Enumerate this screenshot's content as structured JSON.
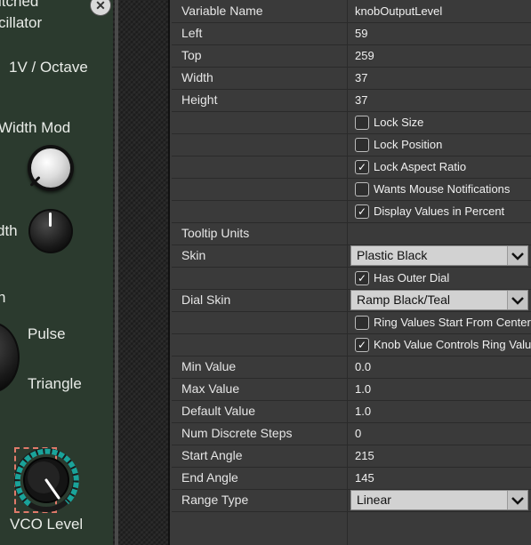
{
  "module": {
    "title_partial": "itched",
    "subtitle_partial": "cillator",
    "labels": {
      "one_v_octave": "1V / Octave",
      "width_mod": "Width Mod",
      "dth": "dth",
      "h": "h",
      "pulse": "Pulse",
      "triangle": "Triangle",
      "vco_level": "VCO Level"
    },
    "accent_color": "#1aa39a",
    "selection_color": "#e07a6a"
  },
  "properties": {
    "rows": [
      {
        "name": "Variable Name",
        "value": "knobOutputLevel"
      },
      {
        "name": "Left",
        "value": "59"
      },
      {
        "name": "Top",
        "value": "259"
      },
      {
        "name": "Width",
        "value": "37"
      },
      {
        "name": "Height",
        "value": "37"
      }
    ],
    "checkboxes_a": [
      {
        "label": "Lock Size",
        "checked": false
      },
      {
        "label": "Lock Position",
        "checked": false
      },
      {
        "label": "Lock Aspect Ratio",
        "checked": true
      },
      {
        "label": "Wants Mouse Notifications",
        "checked": false
      },
      {
        "label": "Display Values in Percent",
        "checked": true
      }
    ],
    "tooltip_units": {
      "name": "Tooltip Units",
      "value": ""
    },
    "skin": {
      "name": "Skin",
      "value": "Plastic Black"
    },
    "has_outer_dial": {
      "label": "Has Outer Dial",
      "checked": true
    },
    "dial_skin": {
      "name": "Dial Skin",
      "value": "Ramp Black/Teal"
    },
    "checkboxes_b": [
      {
        "label": "Ring Values Start From Center",
        "checked": false
      },
      {
        "label": "Knob Value Controls Ring Value",
        "checked": true
      }
    ],
    "rows_b": [
      {
        "name": "Min Value",
        "value": "0.0"
      },
      {
        "name": "Max Value",
        "value": "1.0"
      },
      {
        "name": "Default Value",
        "value": "1.0"
      },
      {
        "name": "Num Discrete Steps",
        "value": "0"
      },
      {
        "name": "Start Angle",
        "value": "215"
      },
      {
        "name": "End Angle",
        "value": "145"
      }
    ],
    "range_type": {
      "name": "Range Type",
      "value": "Linear"
    }
  }
}
